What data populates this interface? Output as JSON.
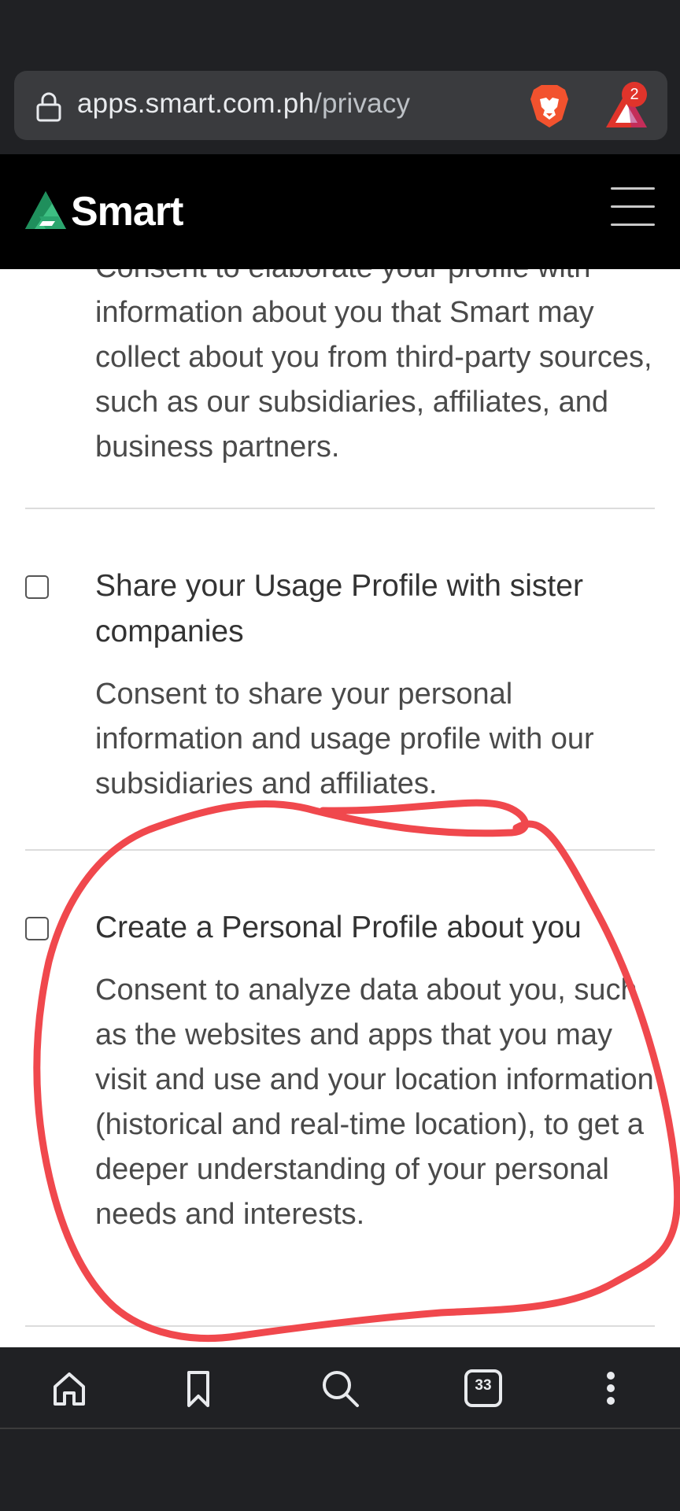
{
  "browser": {
    "url_host": "apps.smart.com.ph",
    "url_path": "/privacy",
    "rewards_badge_count": "2",
    "tab_count": "33"
  },
  "site": {
    "logo_text": "Smart"
  },
  "consents": {
    "intro_lines": {
      "partial": "Consent to elaborate your profile with",
      "body": "information about you that Smart may collect about you from third-party sources, such as our subsidiaries, affiliates, and business partners."
    },
    "items": [
      {
        "title": "Share your Usage Profile with sister companies",
        "description": "Consent to share your personal information and usage profile with our subsidiaries and affiliates.",
        "checked": false
      },
      {
        "title": "Create a Personal Profile about you",
        "description": "Consent to analyze data about you, such as the websites and apps that you may visit and use and your location information (historical and real-time location), to get a deeper understanding of your personal needs and interests.",
        "checked": false
      }
    ]
  },
  "colors": {
    "annotation": "#f0484d",
    "logo_green": "#3dbf82",
    "brave_orange": "#f2522e"
  }
}
